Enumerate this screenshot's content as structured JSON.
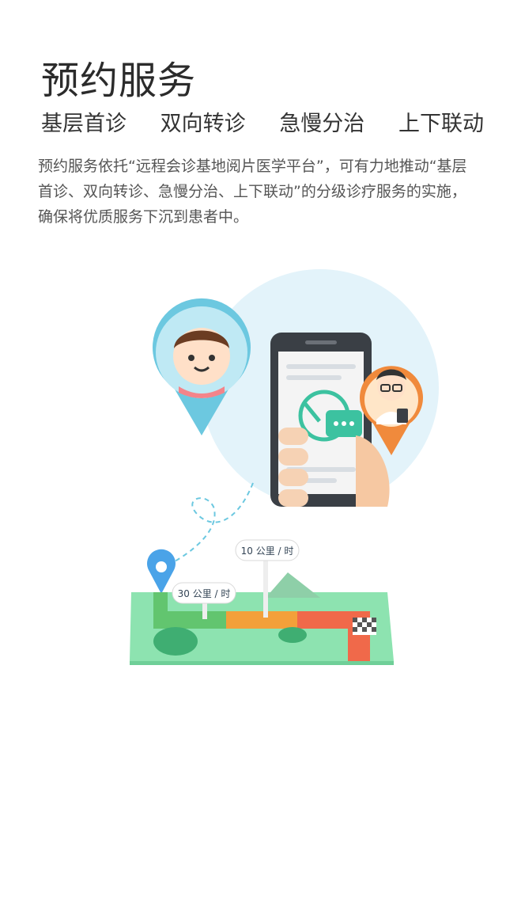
{
  "page": {
    "title": "预约服务",
    "tagline": [
      "基层首诊",
      "双向转诊",
      "急慢分治",
      "上下联动"
    ],
    "description": "预约服务依托“远程会诊基地阅片医学平台”，可有力地推动“基层首诊、双向转诊、急慢分治、上下联动”的分级诊疗服务的实施，确保将优质服务下沉到患者中。"
  },
  "illustration": {
    "speed_sign_1": "10 公里 / 时",
    "speed_sign_2": "30 公里 / 时",
    "icons": [
      "patient-avatar-icon",
      "doctor-avatar-icon",
      "smartphone-icon",
      "location-pin-icon",
      "chat-bubble-icon",
      "checkered-flag-icon"
    ],
    "colors": {
      "circle_bg": "#e3f3fa",
      "pin_blue": "#4aa3e8",
      "patient_pin": "#6cc8e0",
      "doctor_pin": "#f08a3c",
      "map_green": "#8de3b0",
      "road_orange": "#f3a03a",
      "road_red": "#f0694a"
    }
  }
}
